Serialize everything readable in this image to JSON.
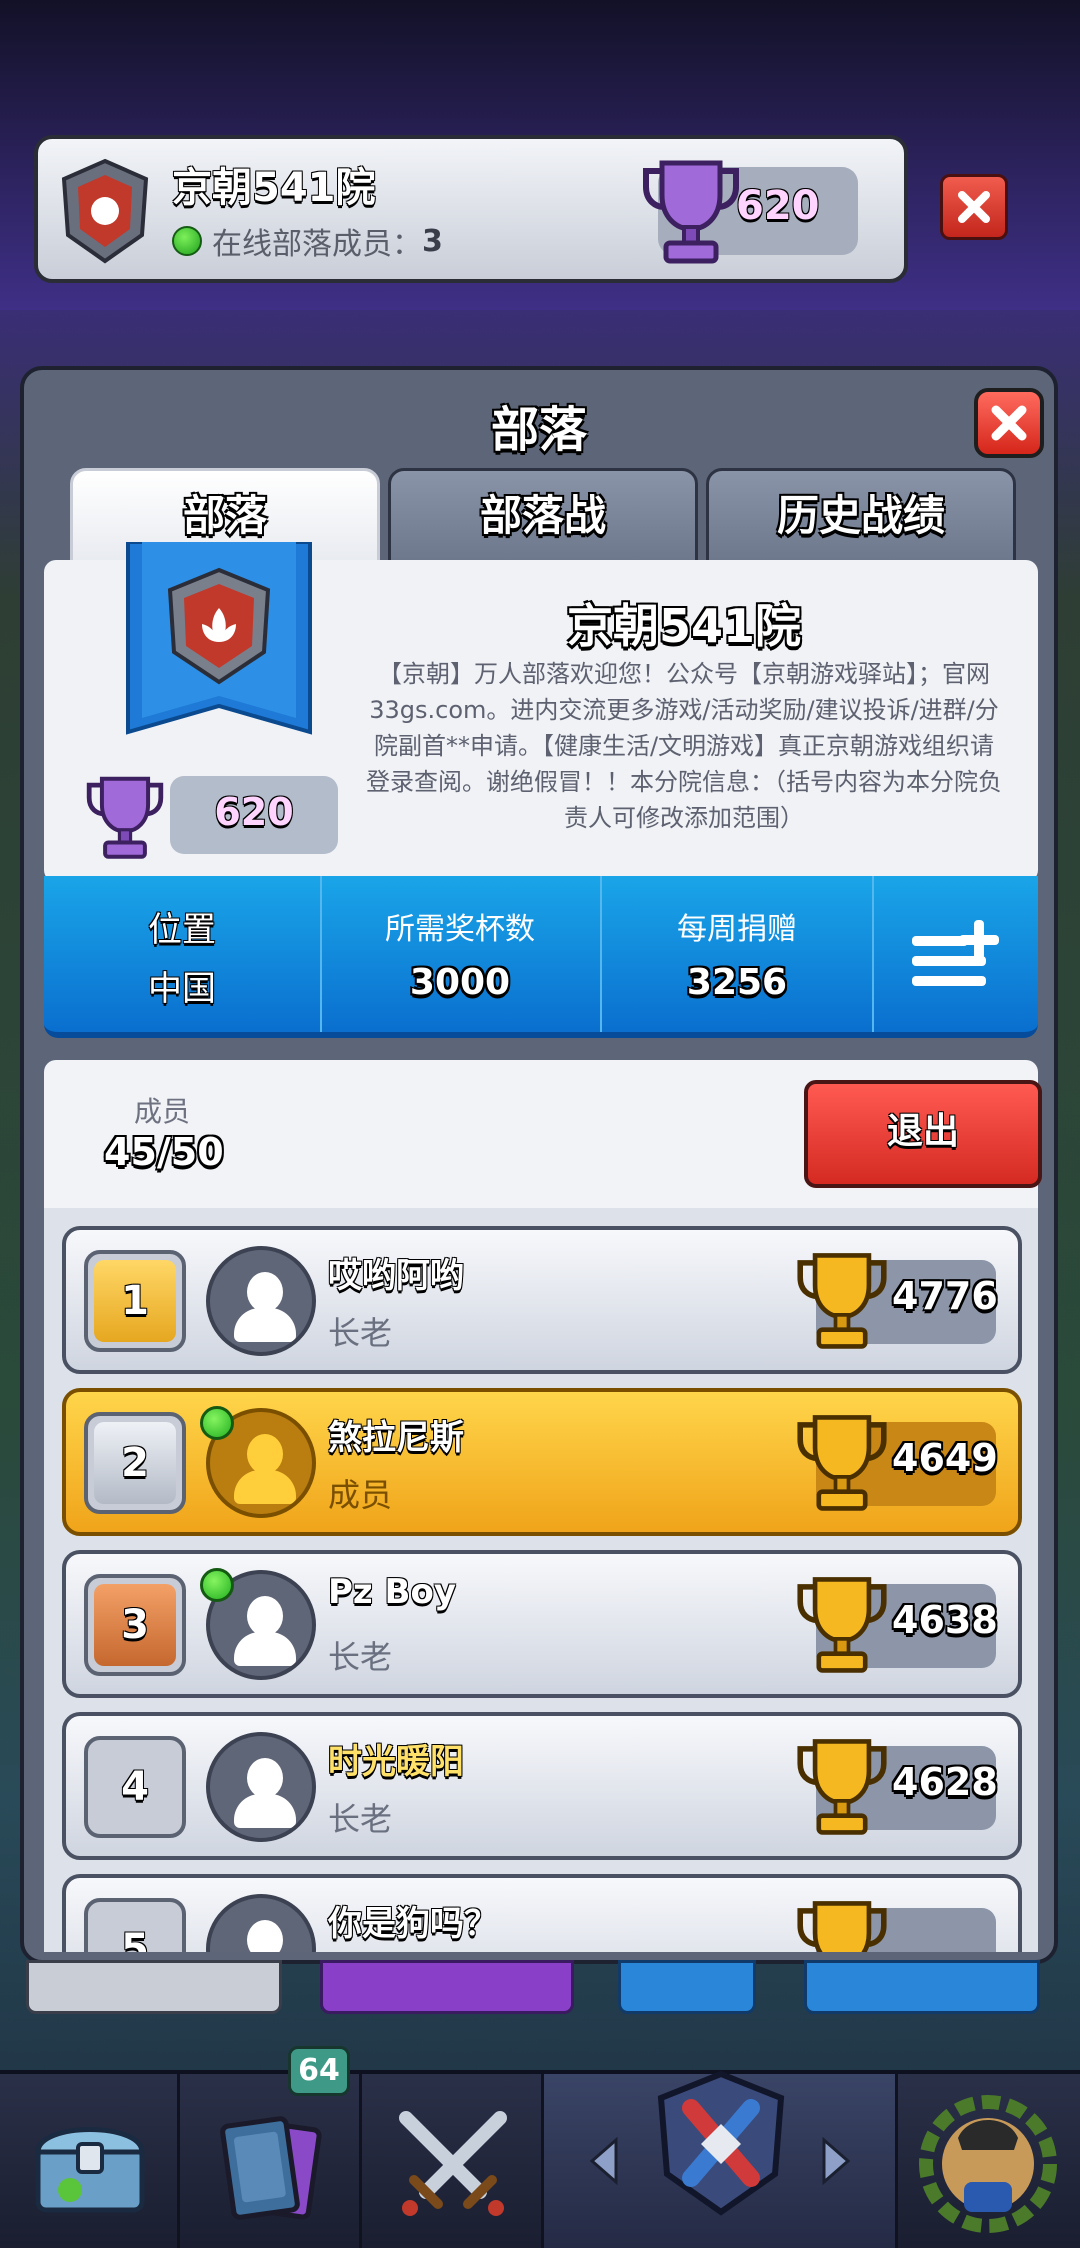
{
  "top_bar": {
    "clan_name": "京朝541院",
    "online_label": "在线部落成员：",
    "online_count": "3",
    "trophies": "620"
  },
  "panel": {
    "title": "部落",
    "tabs": [
      {
        "label": "部落",
        "active": true
      },
      {
        "label": "部落战",
        "active": false
      },
      {
        "label": "历史战绩",
        "active": false
      }
    ]
  },
  "clan_info": {
    "name": "京朝541院",
    "description": "【京朝】万人部落欢迎您！公众号【京朝游戏驿站】；官网33gs.com。进内交流更多游戏/活动奖励/建议投诉/进群/分院副首**申请。【健康生活/文明游戏】真正京朝游戏组织请登录查阅。谢绝假冒！！本分院信息：（括号内容为本分院负责人可修改添加范围）",
    "trophies": "620"
  },
  "stats": {
    "location_label": "位置",
    "location_value": "中国",
    "required_trophies_label": "所需奖杯数",
    "required_trophies_value": "3000",
    "weekly_donations_label": "每周捐赠",
    "weekly_donations_value": "3256"
  },
  "members": {
    "label": "成员",
    "count": "45/50",
    "leave_label": "退出",
    "list": [
      {
        "rank": "1",
        "name": "哎哟阿哟",
        "role": "长老",
        "trophies": "4776",
        "online": false,
        "highlight": false
      },
      {
        "rank": "2",
        "name": "煞拉尼斯",
        "role": "成员",
        "trophies": "4649",
        "online": true,
        "highlight": true
      },
      {
        "rank": "3",
        "name": "Pz Boy",
        "role": "长老",
        "trophies": "4638",
        "online": true,
        "highlight": false
      },
      {
        "rank": "4",
        "name": "时光暖阳",
        "role": "长老",
        "trophies": "4628",
        "online": false,
        "highlight": false
      },
      {
        "rank": "5",
        "name": "你是狗吗？",
        "role": "",
        "trophies": "",
        "online": false,
        "highlight": false
      }
    ]
  },
  "bottom_nav": {
    "cards_badge": "64",
    "items": [
      "chest-icon",
      "cards-icon",
      "battle-icon",
      "clan-icon",
      "tournament-icon"
    ]
  },
  "colors": {
    "accent_blue": "#0a8be0",
    "leave_red": "#e6352c",
    "highlight_gold": "#f5b52a",
    "trophy_purple": "#9b5fd6"
  }
}
